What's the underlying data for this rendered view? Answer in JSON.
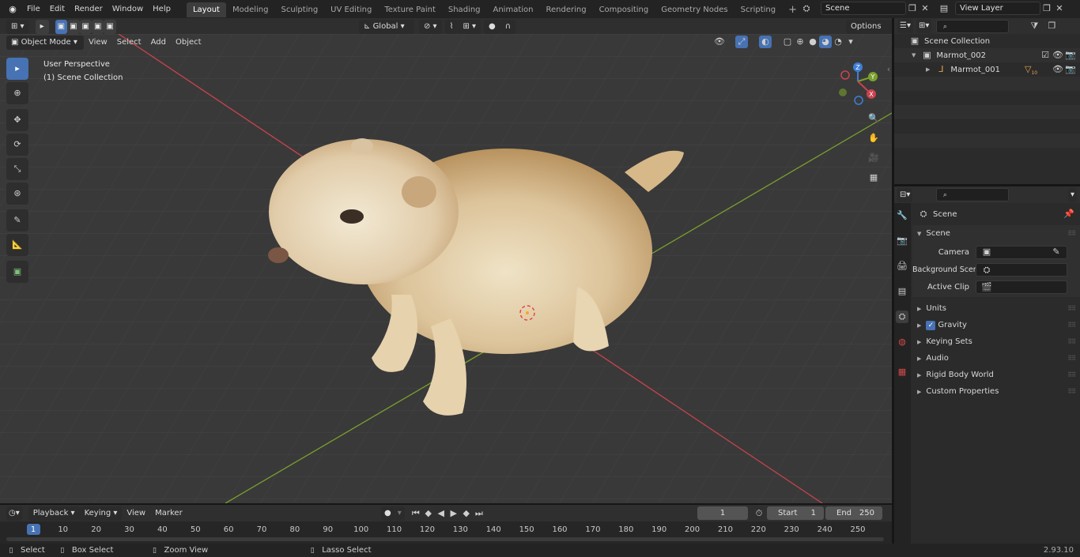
{
  "topbar": {
    "menus": [
      "File",
      "Edit",
      "Render",
      "Window",
      "Help"
    ],
    "workspaces": [
      "Layout",
      "Modeling",
      "Sculpting",
      "UV Editing",
      "Texture Paint",
      "Shading",
      "Animation",
      "Rendering",
      "Compositing",
      "Geometry Nodes",
      "Scripting"
    ],
    "active_workspace": "Layout",
    "scene_name": "Scene",
    "view_layer": "View Layer"
  },
  "viewport_header": {
    "mode": "Object Mode",
    "menus": [
      "View",
      "Select",
      "Add",
      "Object"
    ],
    "orientation": "Global",
    "options_label": "Options"
  },
  "viewport": {
    "perspective_label": "User Perspective",
    "collection_label": "(1) Scene Collection",
    "gizmo_axes": {
      "x": "X",
      "y": "Y",
      "z": "Z"
    }
  },
  "outliner": {
    "root": "Scene Collection",
    "items": [
      {
        "label": "Marmot_002"
      },
      {
        "label": "Marmot_001",
        "badge": "10"
      }
    ]
  },
  "properties": {
    "context_title": "Scene",
    "panel_title": "Scene",
    "fields": [
      {
        "label": "Camera"
      },
      {
        "label": "Background Scene"
      },
      {
        "label": "Active Clip"
      }
    ],
    "subpanels": [
      "Units",
      "Gravity",
      "Keying Sets",
      "Audio",
      "Rigid Body World",
      "Custom Properties"
    ]
  },
  "timeline": {
    "menus": [
      "Playback",
      "Keying",
      "View",
      "Marker"
    ],
    "current_frame": "1",
    "start_label": "Start",
    "start_value": "1",
    "end_label": "End",
    "end_value": "250",
    "ticks": [
      "1",
      "10",
      "20",
      "30",
      "40",
      "50",
      "60",
      "70",
      "80",
      "90",
      "100",
      "110",
      "120",
      "130",
      "140",
      "150",
      "160",
      "170",
      "180",
      "190",
      "200",
      "210",
      "220",
      "230",
      "240",
      "250"
    ]
  },
  "statusbar": {
    "items": [
      "Select",
      "Box Select",
      "Zoom View",
      "Lasso Select"
    ],
    "version": "2.93.10"
  },
  "colors": {
    "accent": "#4772b3",
    "x_axis": "#c9434f",
    "y_axis": "#7aa02d",
    "z_axis": "#3e7fd6"
  }
}
